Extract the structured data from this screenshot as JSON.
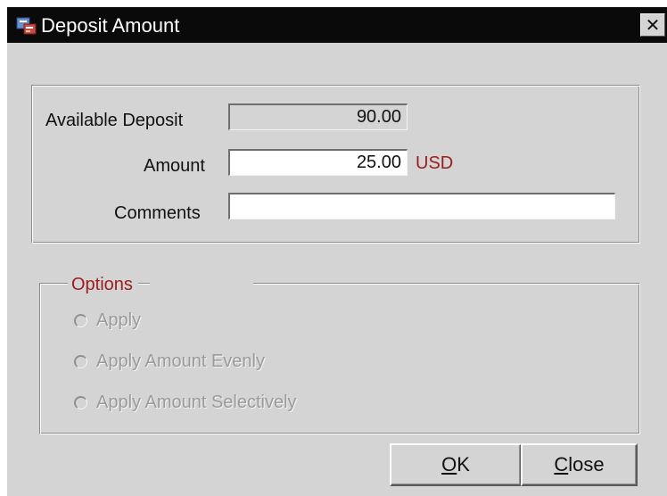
{
  "window": {
    "title": "Deposit Amount",
    "close_glyph": "✕",
    "icon": "app-icon"
  },
  "form": {
    "available_deposit": {
      "label": "Available Deposit",
      "value": "90.00"
    },
    "amount": {
      "label": "Amount",
      "value": "25.00",
      "currency": "USD"
    },
    "comments": {
      "label": "Comments",
      "value": ""
    }
  },
  "options": {
    "legend": "Options",
    "items": [
      {
        "label": "Apply",
        "selected": false,
        "enabled": false
      },
      {
        "label": "Apply Amount Evenly",
        "selected": false,
        "enabled": false
      },
      {
        "label": "Apply Amount Selectively",
        "selected": false,
        "enabled": false
      }
    ]
  },
  "buttons": {
    "ok": {
      "mnemonic": "O",
      "rest": "K"
    },
    "close": {
      "mnemonic": "C",
      "rest": "lose"
    }
  },
  "colors": {
    "accent": "#9b1c1c",
    "window_bg": "#d4d4d4",
    "titlebar": "#0a0a0a"
  }
}
